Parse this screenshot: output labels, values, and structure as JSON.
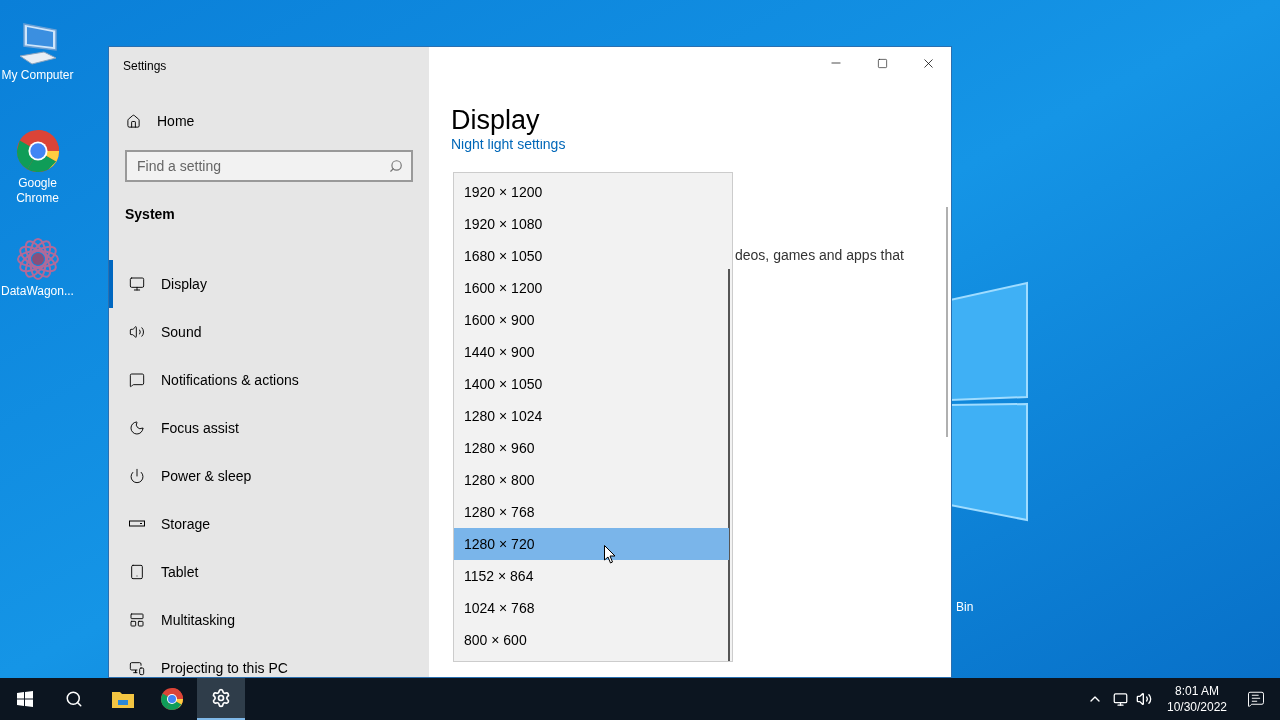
{
  "desktop": {
    "icons": [
      {
        "label": "My Computer"
      },
      {
        "label": "Google Chrome"
      },
      {
        "label": "DataWagon..."
      }
    ],
    "partial_icon_label": "Bin"
  },
  "window": {
    "title": "Settings",
    "home": "Home",
    "search": {
      "placeholder": "Find a setting"
    },
    "section": "System",
    "nav": [
      {
        "label": "Display",
        "selected": true
      },
      {
        "label": "Sound",
        "selected": false
      },
      {
        "label": "Notifications & actions",
        "selected": false
      },
      {
        "label": "Focus assist",
        "selected": false
      },
      {
        "label": "Power & sleep",
        "selected": false
      },
      {
        "label": "Storage",
        "selected": false
      },
      {
        "label": "Tablet",
        "selected": false
      },
      {
        "label": "Multitasking",
        "selected": false
      },
      {
        "label": "Projecting to this PC",
        "selected": false
      }
    ],
    "heading": "Display",
    "link": "Night light settings",
    "text_fragment": "deos, games and apps that",
    "resolutions": [
      {
        "label": "1920 × 1200",
        "selected": false
      },
      {
        "label": "1920 × 1080",
        "selected": false
      },
      {
        "label": "1680 × 1050",
        "selected": false
      },
      {
        "label": "1600 × 1200",
        "selected": false
      },
      {
        "label": "1600 × 900",
        "selected": false
      },
      {
        "label": "1440 × 900",
        "selected": false
      },
      {
        "label": "1400 × 1050",
        "selected": false
      },
      {
        "label": "1280 × 1024",
        "selected": false
      },
      {
        "label": "1280 × 960",
        "selected": false
      },
      {
        "label": "1280 × 800",
        "selected": false
      },
      {
        "label": "1280 × 768",
        "selected": false
      },
      {
        "label": "1280 × 720",
        "selected": true
      },
      {
        "label": "1152 × 864",
        "selected": false
      },
      {
        "label": "1024 × 768",
        "selected": false
      },
      {
        "label": "800 × 600",
        "selected": false
      }
    ]
  },
  "taskbar": {
    "apps": [
      {
        "kind": "start",
        "selected": false
      },
      {
        "kind": "search",
        "selected": false
      },
      {
        "kind": "explorer",
        "selected": false
      },
      {
        "kind": "chrome",
        "selected": false
      },
      {
        "kind": "settings",
        "selected": true
      }
    ],
    "time": "8:01 AM",
    "date": "10/30/2022"
  }
}
